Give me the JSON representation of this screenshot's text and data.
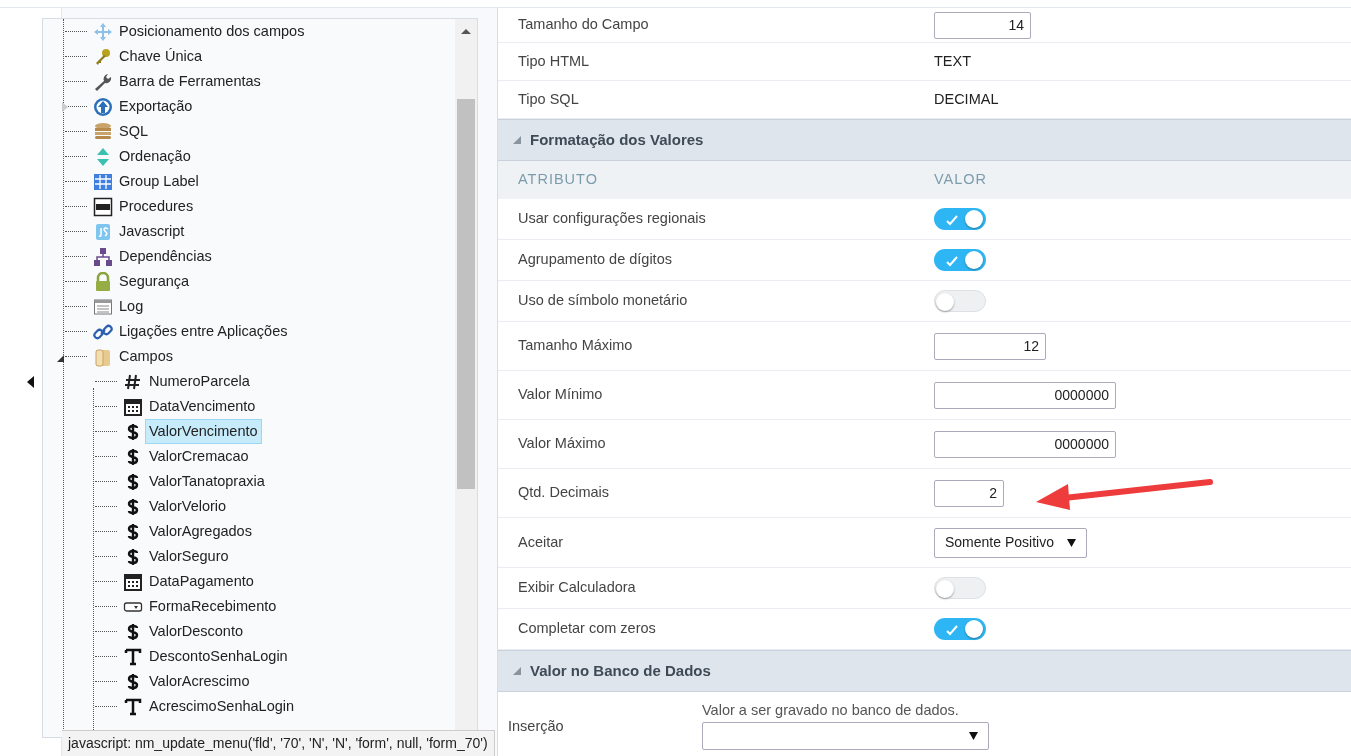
{
  "tree": {
    "items": [
      {
        "label": "Posicionamento dos campos"
      },
      {
        "label": "Chave Única"
      },
      {
        "label": "Barra de Ferramentas"
      },
      {
        "label": "Exportação",
        "expanded": false
      },
      {
        "label": "SQL"
      },
      {
        "label": "Ordenação"
      },
      {
        "label": "Group Label"
      },
      {
        "label": "Procedures"
      },
      {
        "label": "Javascript"
      },
      {
        "label": "Dependências"
      },
      {
        "label": "Segurança"
      },
      {
        "label": "Log"
      },
      {
        "label": "Ligações entre Aplicações"
      },
      {
        "label": "Campos",
        "expanded": true,
        "children": [
          {
            "label": "NumeroParcela",
            "kind": "number",
            "selected": false
          },
          {
            "label": "DataVencimento",
            "kind": "date",
            "selected": false
          },
          {
            "label": "ValorVencimento",
            "kind": "currency",
            "selected": true
          },
          {
            "label": "ValorCremacao",
            "kind": "currency",
            "selected": false
          },
          {
            "label": "ValorTanatopraxia",
            "kind": "currency",
            "selected": false
          },
          {
            "label": "ValorVelorio",
            "kind": "currency",
            "selected": false
          },
          {
            "label": "ValorAgregados",
            "kind": "currency",
            "selected": false
          },
          {
            "label": "ValorSeguro",
            "kind": "currency",
            "selected": false
          },
          {
            "label": "DataPagamento",
            "kind": "date",
            "selected": false
          },
          {
            "label": "FormaRecebimento",
            "kind": "select",
            "selected": false
          },
          {
            "label": "ValorDesconto",
            "kind": "currency",
            "selected": false
          },
          {
            "label": "DescontoSenhaLogin",
            "kind": "text",
            "selected": false
          },
          {
            "label": "ValorAcrescimo",
            "kind": "currency",
            "selected": false
          },
          {
            "label": "AcrescimoSenhaLogin",
            "kind": "text",
            "selected": false
          }
        ]
      }
    ]
  },
  "status_bar": "javascript: nm_update_menu('fld', '70', 'N', 'N', 'form', null, 'form_70')",
  "sections": [
    {
      "rows": [
        {
          "label": "Tamanho do Campo",
          "kind": "input",
          "value": "14"
        },
        {
          "label": "Tipo HTML",
          "kind": "text",
          "value": "TEXT"
        },
        {
          "label": "Tipo SQL",
          "kind": "text",
          "value": "DECIMAL"
        }
      ]
    },
    {
      "title": "Formatação dos Valores",
      "expanded": true,
      "columns": [
        "ATRIBUTO",
        "VALOR"
      ],
      "rows": [
        {
          "label": "Usar configurações regionais",
          "kind": "toggle",
          "on": true
        },
        {
          "label": "Agrupamento de dígitos",
          "kind": "toggle",
          "on": true
        },
        {
          "label": "Uso de símbolo monetário",
          "kind": "toggle",
          "on": false
        },
        {
          "label": "Tamanho Máximo",
          "kind": "input",
          "value": "12"
        },
        {
          "label": "Valor Mínimo",
          "kind": "input",
          "value": "0000000"
        },
        {
          "label": "Valor Máximo",
          "kind": "input",
          "value": "0000000"
        },
        {
          "label": "Qtd. Decimais",
          "kind": "input",
          "value": "2"
        },
        {
          "label": "Aceitar",
          "kind": "select",
          "value": "Somente Positivo"
        },
        {
          "label": "Exibir Calculadora",
          "kind": "toggle",
          "on": false
        },
        {
          "label": "Completar com zeros",
          "kind": "toggle",
          "on": true
        }
      ]
    },
    {
      "title": "Valor no Banco de Dados",
      "expanded": true,
      "rows": [
        {
          "label": "Inserção",
          "kind": "hint-select",
          "hint": "Valor a ser gravado no banco de dados."
        }
      ]
    }
  ]
}
